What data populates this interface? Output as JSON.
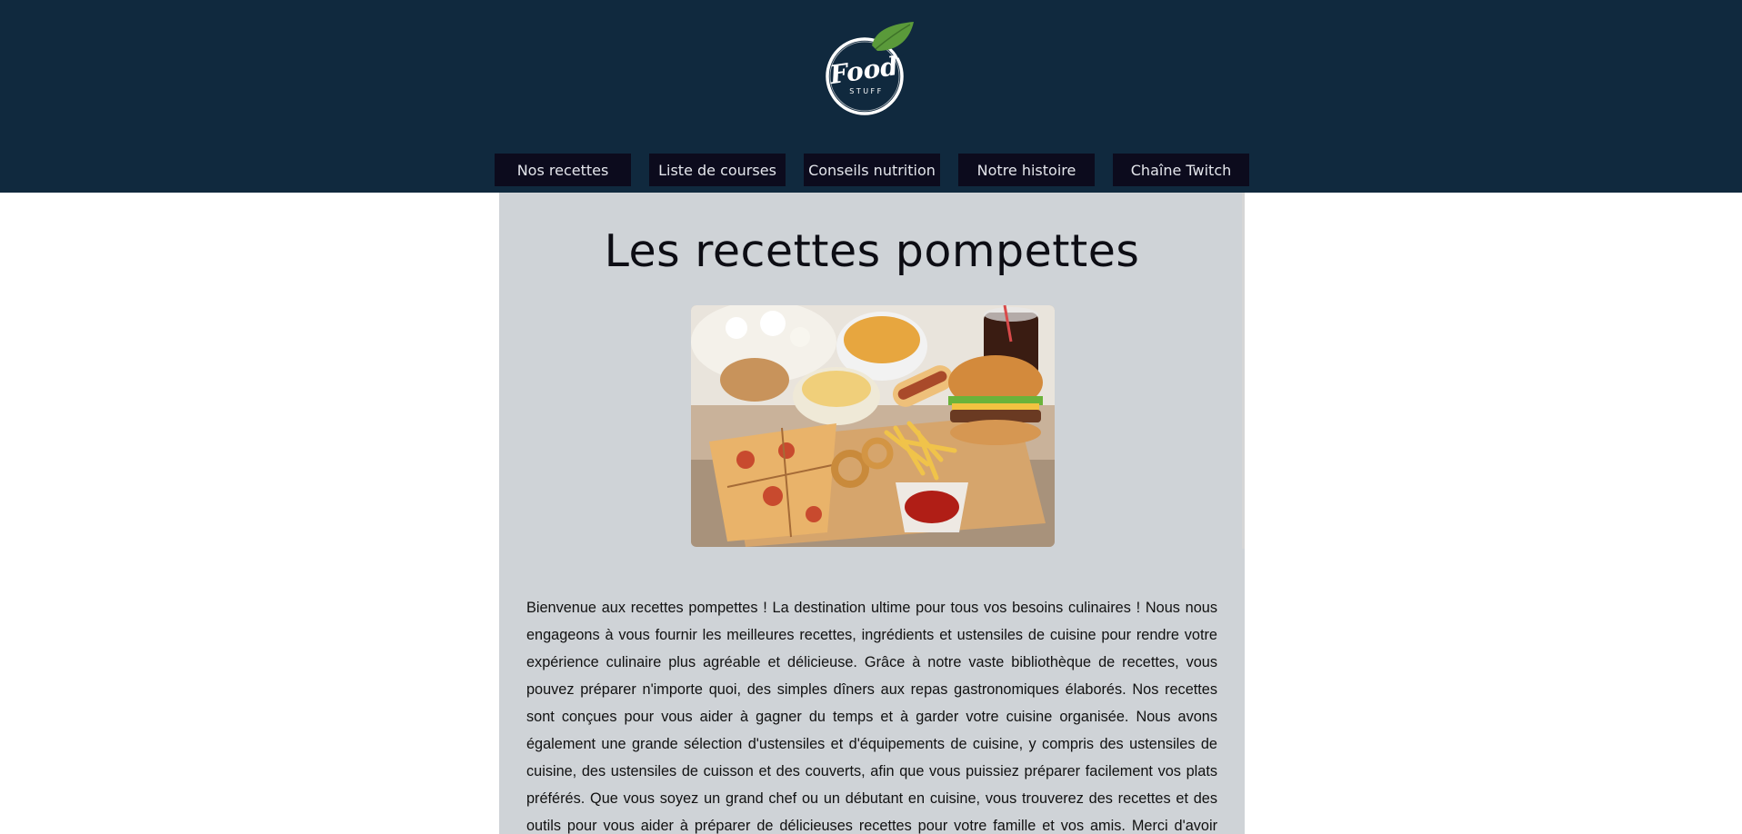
{
  "header": {
    "logo": {
      "brand_top": "Food",
      "brand_bottom": "STUFF"
    },
    "nav": [
      {
        "label": "Nos recettes"
      },
      {
        "label": "Liste de courses"
      },
      {
        "label": "Conseils nutrition"
      },
      {
        "label": "Notre histoire"
      },
      {
        "label": "Chaîne Twitch"
      }
    ]
  },
  "main": {
    "title": "Les recettes pompettes",
    "image": {
      "icon": "fast-food-platter"
    },
    "paragraph": "Bienvenue aux recettes pompettes ! La destination ultime pour tous vos besoins culinaires ! Nous nous engageons à vous fournir les meilleures recettes, ingrédients et ustensiles de cuisine pour rendre votre expérience culinaire plus agréable et délicieuse. Grâce à notre vaste bibliothèque de recettes, vous pouvez préparer n'importe quoi, des simples dîners aux repas gastronomiques élaborés. Nos recettes sont conçues pour vous aider à gagner du temps et à garder votre cuisine organisée. Nous avons également une grande sélection d'ustensiles et d'équipements de cuisine, y compris des ustensiles de cuisine, des ustensiles de cuisson et des couverts, afin que vous puissiez préparer facilement vos plats préférés. Que vous soyez un grand chef ou un débutant en cuisine, vous trouverez des recettes et des outils pour vous aider à préparer de délicieuses recettes pour votre famille et vos amis. Merci d'avoir choisi notre site et"
  },
  "colors": {
    "header_bg": "#10293e",
    "nav_bg": "#0c0b1d",
    "content_bg": "#cfd3d7",
    "leaf_green": "#5a9a3a"
  }
}
